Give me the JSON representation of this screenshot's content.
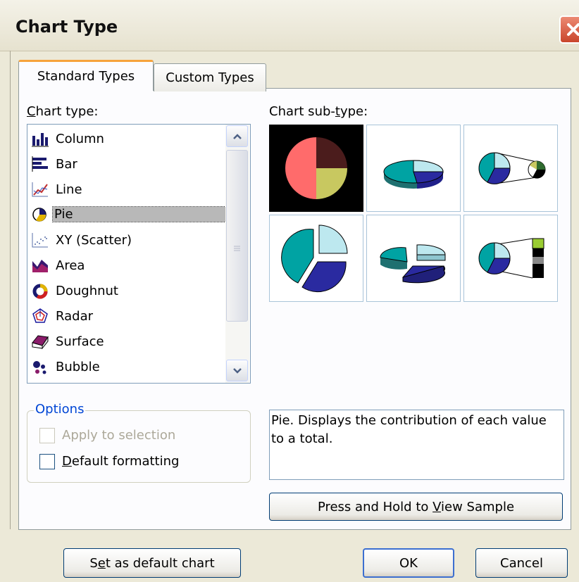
{
  "window": {
    "title": "Chart Type"
  },
  "tabs": [
    {
      "label": "Standard Types",
      "active": true
    },
    {
      "label": "Custom Types",
      "active": false
    }
  ],
  "chart_type": {
    "label_prefix": "",
    "label_accel": "C",
    "label_rest": "hart type:",
    "items": [
      {
        "label": "Column",
        "icon": "column-chart-icon"
      },
      {
        "label": "Bar",
        "icon": "bar-chart-icon"
      },
      {
        "label": "Line",
        "icon": "line-chart-icon"
      },
      {
        "label": "Pie",
        "icon": "pie-chart-icon",
        "selected": true
      },
      {
        "label": "XY (Scatter)",
        "icon": "scatter-chart-icon"
      },
      {
        "label": "Area",
        "icon": "area-chart-icon"
      },
      {
        "label": "Doughnut",
        "icon": "doughnut-chart-icon"
      },
      {
        "label": "Radar",
        "icon": "radar-chart-icon"
      },
      {
        "label": "Surface",
        "icon": "surface-chart-icon"
      },
      {
        "label": "Bubble",
        "icon": "bubble-chart-icon"
      }
    ]
  },
  "sub_type": {
    "label_prefix": "Chart sub-",
    "label_accel": "t",
    "label_rest": "ype:"
  },
  "options": {
    "title": "Options",
    "apply_to_selection": "Apply to selection",
    "default_formatting_accel": "D",
    "default_formatting_rest": "efault formatting"
  },
  "description": "Pie. Displays the contribution of each value to a total.",
  "buttons": {
    "sample_prefix": "Press and Hold to ",
    "sample_accel": "V",
    "sample_rest": "iew Sample",
    "default_prefix": "S",
    "default_accel": "e",
    "default_rest": "t as default chart",
    "ok": "OK",
    "cancel": "Cancel"
  },
  "colors": {
    "pie_salmon": "#ff6b6b",
    "pie_maroon": "#4b1c1c",
    "pie_olive": "#c8c860",
    "pie_teal": "#00a3a3",
    "pie_navy": "#2a2aa0",
    "pie_lightcyan": "#bde8ef",
    "tab_accent": "#f7a33b",
    "group_title": "#0046d5"
  }
}
